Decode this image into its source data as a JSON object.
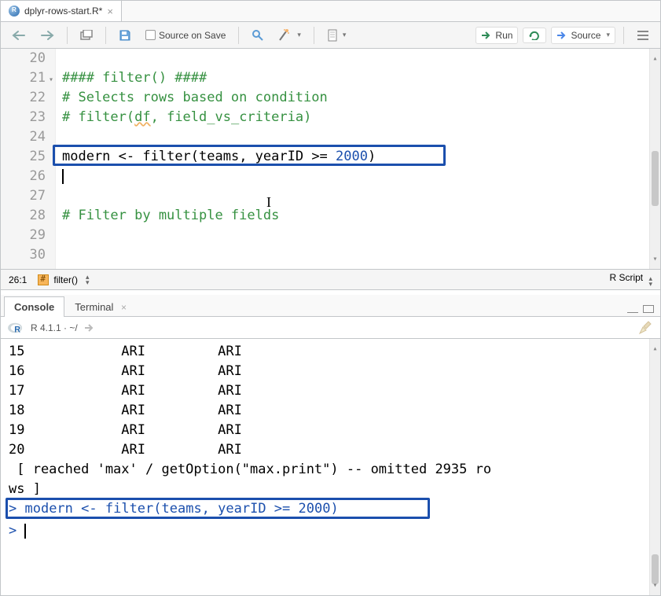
{
  "editor": {
    "tab_title": "dplyr-rows-start.R*",
    "toolbar": {
      "source_on_save": "Source on Save",
      "run": "Run",
      "source": "Source"
    },
    "lines": [
      {
        "n": 20,
        "tokens": []
      },
      {
        "n": 21,
        "fold": true,
        "tokens": [
          {
            "t": "#### filter() ####",
            "cls": "c-comment"
          }
        ]
      },
      {
        "n": 22,
        "tokens": [
          {
            "t": "# Selects rows based on condition",
            "cls": "c-comment"
          }
        ]
      },
      {
        "n": 23,
        "tokens": [
          {
            "t": "# filter(",
            "cls": "c-comment"
          },
          {
            "t": "df",
            "cls": "c-comment c-squig"
          },
          {
            "t": ", field_vs_criteria)",
            "cls": "c-comment"
          }
        ]
      },
      {
        "n": 24,
        "tokens": []
      },
      {
        "n": 25,
        "tokens": [
          {
            "t": "modern ",
            "cls": "c-ident"
          },
          {
            "t": "<- ",
            "cls": "c-op"
          },
          {
            "t": "filter(teams, yearID ",
            "cls": "c-ident"
          },
          {
            "t": ">= ",
            "cls": "c-op"
          },
          {
            "t": "2000",
            "cls": "c-num"
          },
          {
            "t": ")",
            "cls": "c-ident"
          }
        ]
      },
      {
        "n": 26,
        "caret": true,
        "tokens": []
      },
      {
        "n": 27,
        "tokens": []
      },
      {
        "n": 28,
        "tokens": [
          {
            "t": "# Filter by multiple fields",
            "cls": "c-comment"
          }
        ]
      },
      {
        "n": 29,
        "tokens": []
      },
      {
        "n": 30,
        "tokens": []
      }
    ],
    "highlight_line": 25,
    "statusbar": {
      "pos": "26:1",
      "section": "filter()",
      "filetype": "R Script"
    }
  },
  "console": {
    "tabs": {
      "console": "Console",
      "terminal": "Terminal"
    },
    "info": "R 4.1.1 · ~/",
    "output_rows": [
      "15            ARI         ARI",
      "16            ARI         ARI",
      "17            ARI         ARI",
      "18            ARI         ARI",
      "19            ARI         ARI",
      "20            ARI         ARI",
      " [ reached 'max' / getOption(\"max.print\") -- omitted 2935 ro",
      "ws ]"
    ],
    "cmd_tokens": [
      {
        "t": "modern ",
        "cls": "c-ident"
      },
      {
        "t": "<- ",
        "cls": "c-op"
      },
      {
        "t": "filter(teams, yearID ",
        "cls": "c-ident"
      },
      {
        "t": ">= ",
        "cls": "c-op"
      },
      {
        "t": "2000",
        "cls": "c-num"
      },
      {
        "t": ")",
        "cls": "c-ident"
      }
    ]
  }
}
